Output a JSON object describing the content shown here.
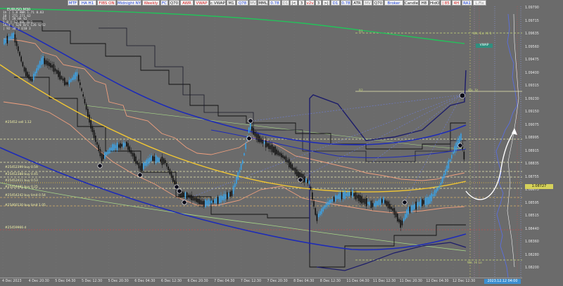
{
  "symbol": "EURUSD,M30",
  "toolbar": {
    "buttons": [
      {
        "label": "MTF",
        "color": "#1b3fd8"
      },
      {
        "label": "HA H1",
        "color": "#1b3fd8"
      },
      {
        "label": "FIBS ON",
        "color": "#d62020"
      },
      {
        "label": "Midnight NY",
        "color": "#1b3fd8"
      },
      {
        "label": "Weekly",
        "color": "#d62020"
      },
      {
        "label": "FC",
        "color": "#1b3fd8"
      },
      {
        "label": "Q70",
        "color": "#111111"
      },
      {
        "label": "AWR",
        "color": "#d62020"
      },
      {
        "label": "VWAP",
        "color": "#d62020"
      },
      {
        "label": "c.VWAP",
        "color": "#111111"
      },
      {
        "label": "M1",
        "color": "#111111"
      },
      {
        "label": "Q78",
        "color": "#1b3fd8"
      },
      {
        "label": "MV",
        "color": "#888888"
      },
      {
        "label": "MML",
        "color": "#111111"
      },
      {
        "label": "0.78",
        "color": "#1b3fd8"
      },
      {
        "label": "D1",
        "color": "#888888"
      },
      {
        "label": "|<",
        "color": "#111111"
      },
      {
        "label": "3",
        "color": "#111111"
      },
      {
        "label": "v2v",
        "color": "#d62020"
      },
      {
        "label": "3",
        "color": "#111111"
      },
      {
        "label": ">|",
        "color": "#111111"
      },
      {
        "label": "D1",
        "color": "#1b3fd8"
      },
      {
        "label": "0.78",
        "color": "#1b3fd8"
      },
      {
        "label": "ATR",
        "color": "#111111"
      },
      {
        "label": "MV",
        "color": "#888888"
      },
      {
        "label": "Q70",
        "color": "#111111"
      },
      {
        "label": "Broker",
        "color": "#1b3fd8"
      },
      {
        "label": "Candle",
        "color": "#111111"
      },
      {
        "label": "H8",
        "color": "#111111"
      },
      {
        "label": "HidO",
        "color": "#111111"
      },
      {
        "label": "| 85",
        "color": "#d62020"
      },
      {
        "label": "4H",
        "color": "#d62020"
      },
      {
        "label": "RA1",
        "color": "#1b3fd8"
      },
      {
        "label": "L.Fix",
        "color": "#888888"
      }
    ]
  },
  "info_panel": {
    "rows": [
      "  1h  |  1.8   AWR  1.71   0.83",
      "  18   |  271   271    62",
      "  D1   |  28   HA   V2",
      "  5.8  |  52   VOL   R/1",
      "  19/4  |  S26   B/1  C26   S/52",
      "       |  92    30   2  E10  3"
    ]
  },
  "price_axis": {
    "labels": [
      "1.09790",
      "1.09715",
      "1.09635",
      "1.09560",
      "1.09475",
      "1.09400",
      "1.09315",
      "1.09230",
      "1.09150",
      "1.09075",
      "1.08995",
      "1.08915",
      "1.08835",
      "1.08755",
      "1.08675",
      "1.08595",
      "1.08515",
      "1.08440",
      "1.08360",
      "1.08280",
      "1.08200"
    ],
    "current": "1.08727"
  },
  "time_axis": {
    "labels": [
      "4 Dec 2023",
      "4 Dec 20:30",
      "5 Dec 04:30",
      "5 Dec 12:30",
      "5 Dec 20:30",
      "6 Dec 04:30",
      "6 Dec 12:30",
      "6 Dec 20:30",
      "7 Dec 04:30",
      "7 Dec 12:30",
      "7 Dec 20:30",
      "8 Dec 04:30",
      "8 Dec 12:30",
      "11 Dec 04:30",
      "11 Dec 12:30",
      "11 Dec 20:30",
      "12 Dec 04:30",
      "12 Dec 12:30"
    ],
    "cursor": "2023.12.12 04:00"
  },
  "order_labels": [
    "#25452 sell 1.12",
    "#25452399 buy 0.59",
    "#25452388 buy 0.45",
    "#25452411 buy 0.53",
    "#25454481 buy 0.25",
    "#25454242 buy limit 0.54",
    "#25460130 buy limit 1.05",
    "#25459966 d"
  ],
  "level_labels": {
    "top_right": "Wk. Ex. Hi 1",
    "r1": "R1",
    "mid_right": "Wk. St",
    "r2": "R2",
    "bottom_right": "Wk. Hi Lo"
  },
  "vwap_label": "VWAP",
  "colors": {
    "background": "#6b6b6b",
    "candle_up": "#3aa3e8",
    "candle_down": "#111111",
    "bb_blue": "#1d2bb8",
    "regression_yellow": "#f2c733",
    "ma_salmon": "#f0a07e",
    "ma_green": "#23c25a",
    "price_tag": "#d6d25a"
  }
}
